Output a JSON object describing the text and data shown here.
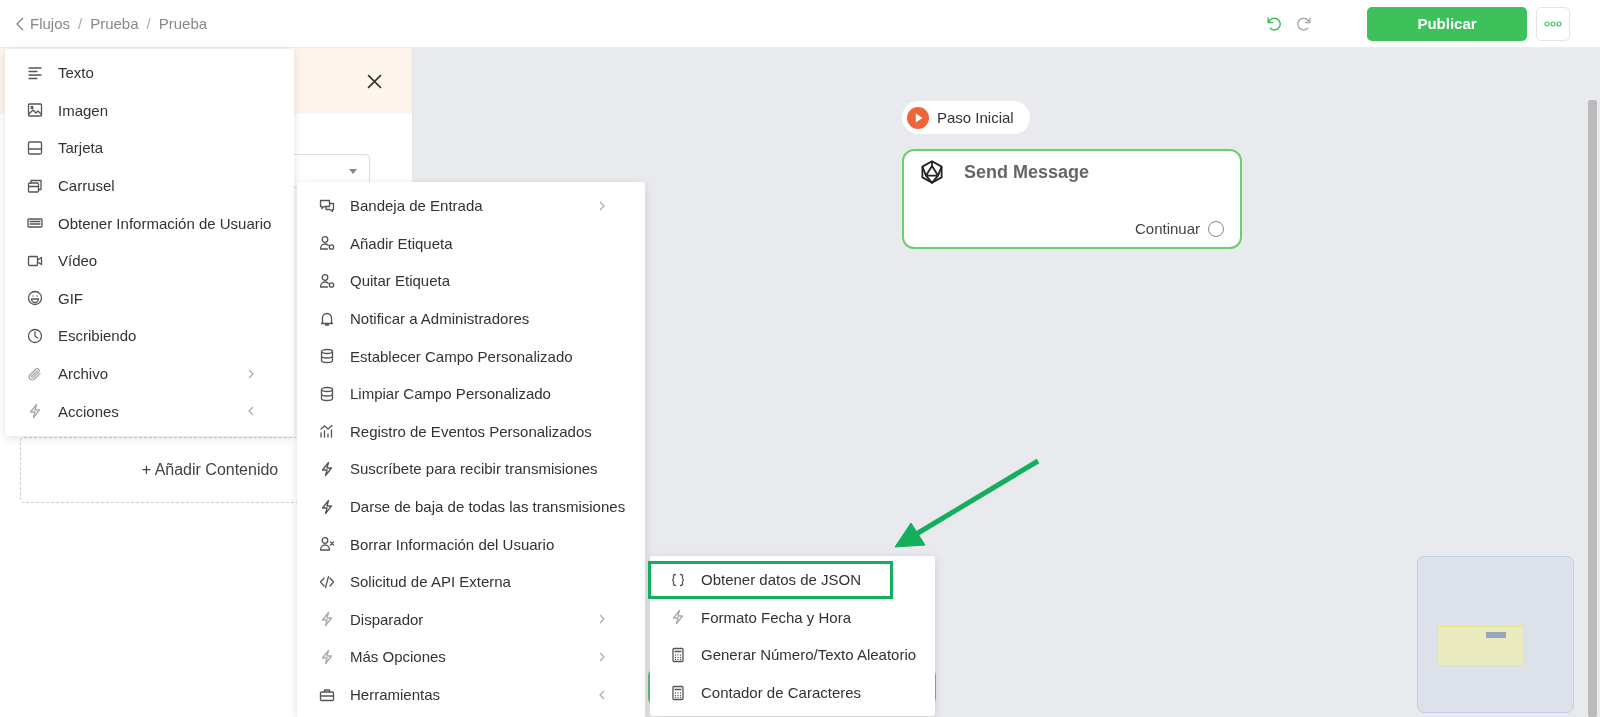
{
  "breadcrumb": {
    "items": [
      "Flujos",
      "Prueba",
      "Prueba"
    ],
    "separator": "/"
  },
  "toolbar": {
    "history": [
      {
        "kind": "undo",
        "disabled": false
      },
      {
        "kind": "redo",
        "disabled": true
      }
    ],
    "publish": "Publicar"
  },
  "content_menu": {
    "items": [
      {
        "label": "Texto",
        "kind": "text",
        "has_submenu": false
      },
      {
        "label": "Imagen",
        "kind": "image",
        "has_submenu": false
      },
      {
        "label": "Tarjeta",
        "kind": "card",
        "has_submenu": false
      },
      {
        "label": "Carrusel",
        "kind": "carousel",
        "has_submenu": false
      },
      {
        "label": "Obtener Información de Usuario",
        "kind": "keyboard",
        "has_submenu": false
      },
      {
        "label": "Vídeo",
        "kind": "video",
        "has_submenu": false
      },
      {
        "label": "GIF",
        "kind": "smiley",
        "has_submenu": false
      },
      {
        "label": "Escribiendo",
        "kind": "clock",
        "has_submenu": false
      },
      {
        "label": "Archivo",
        "kind": "clip",
        "has_submenu": true,
        "expanded": false
      },
      {
        "label": "Acciones",
        "kind": "bolt",
        "has_submenu": true,
        "expanded": true
      }
    ]
  },
  "actions_menu": {
    "items": [
      {
        "label": "Bandeja de Entrada",
        "kind": "chat",
        "has_submenu": true,
        "expanded": false
      },
      {
        "label": "Añadir Etiqueta",
        "kind": "usertag",
        "has_submenu": false
      },
      {
        "label": "Quitar Etiqueta",
        "kind": "usertag",
        "has_submenu": false
      },
      {
        "label": "Notificar a Administradores",
        "kind": "bell",
        "has_submenu": false
      },
      {
        "label": "Establecer Campo Personalizado",
        "kind": "database",
        "has_submenu": false
      },
      {
        "label": "Limpiar Campo Personalizado",
        "kind": "database",
        "has_submenu": false
      },
      {
        "label": "Registro de Eventos Personalizados",
        "kind": "chart",
        "has_submenu": false
      },
      {
        "label": "Suscríbete para recibir transmisiones",
        "kind": "bolt",
        "has_submenu": false
      },
      {
        "label": "Darse de baja de todas las transmisiones",
        "kind": "bolt",
        "has_submenu": false
      },
      {
        "label": "Borrar Información del Usuario",
        "kind": "userx",
        "has_submenu": false
      },
      {
        "label": "Solicitud de API Externa",
        "kind": "code",
        "has_submenu": false
      },
      {
        "label": "Disparador",
        "kind": "bolt",
        "has_submenu": true,
        "expanded": false
      },
      {
        "label": "Más Opciones",
        "kind": "bolt",
        "has_submenu": true,
        "expanded": false
      },
      {
        "label": "Herramientas",
        "kind": "toolbox",
        "has_submenu": true,
        "expanded": true
      }
    ]
  },
  "tools_menu": {
    "items": [
      {
        "label": "Obtener datos de JSON",
        "kind": "braces",
        "selected": true
      },
      {
        "label": "Formato Fecha y Hora",
        "kind": "bolt",
        "selected": false
      },
      {
        "label": "Generar Número/Texto Aleatorio",
        "kind": "calculator",
        "selected": false
      },
      {
        "label": "Contador de Caracteres",
        "kind": "calculator",
        "selected": false
      }
    ]
  },
  "panel": {
    "add_content": "+ Añadir Contenido"
  },
  "canvas": {
    "start_label": "Paso Inicial",
    "node": {
      "title": "Send Message",
      "output": "Continuar"
    }
  }
}
